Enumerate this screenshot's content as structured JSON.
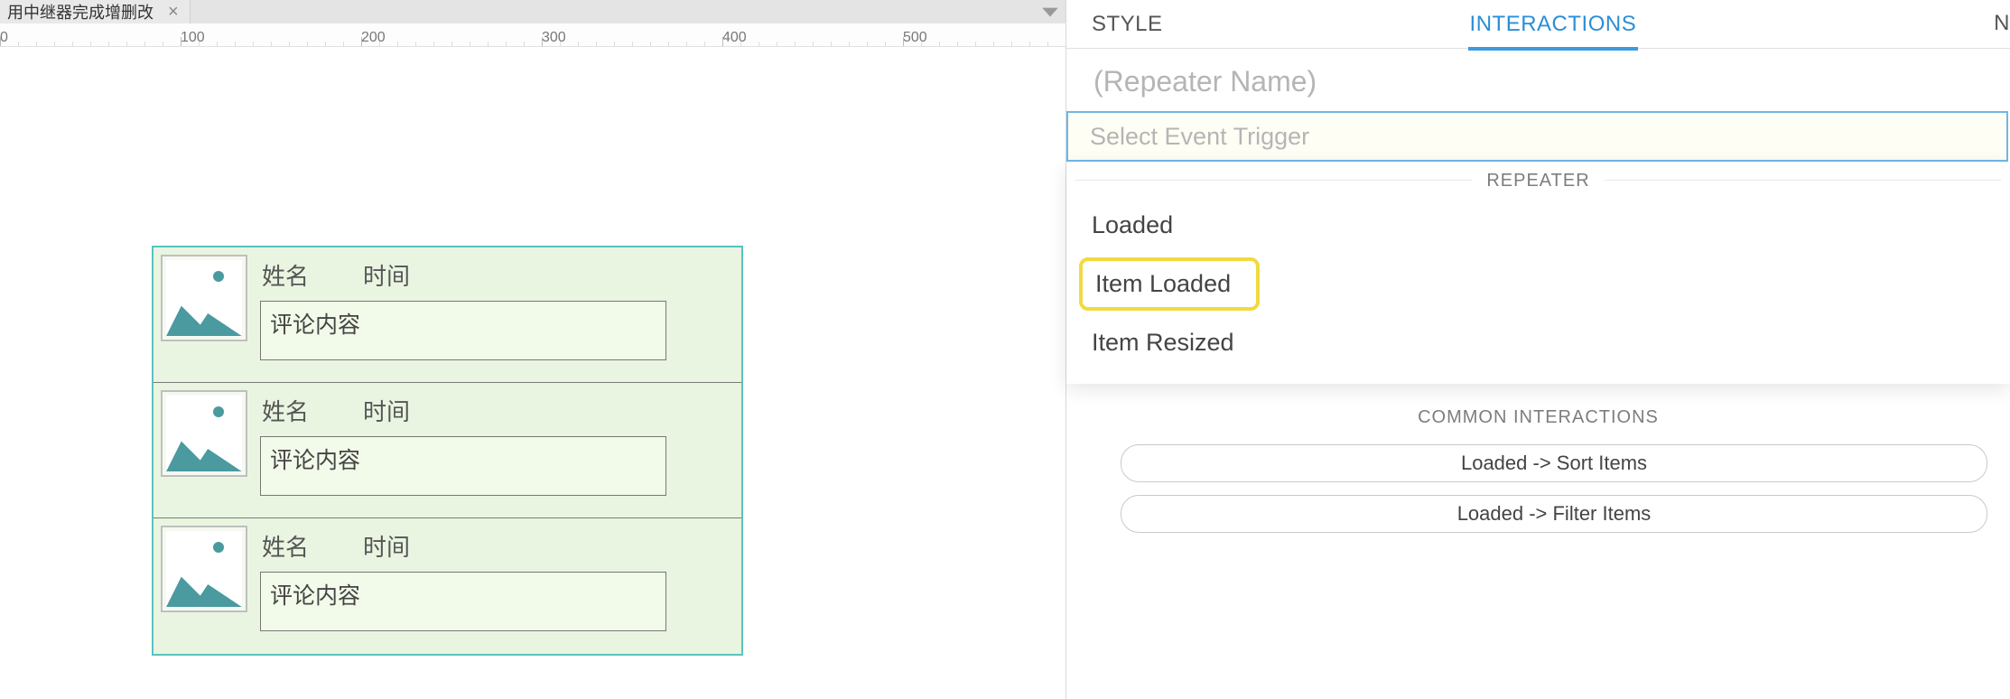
{
  "tab": {
    "title": "用中继器完成增删改"
  },
  "ruler": {
    "marks": [
      "0",
      "100",
      "200",
      "300",
      "400",
      "500"
    ]
  },
  "repeater_item": {
    "name_label": "姓名",
    "time_label": "时间",
    "comment_label": "评论内容"
  },
  "panel": {
    "tabs": {
      "style": "STYLE",
      "interactions": "INTERACTIONS",
      "notes_partial": "N"
    },
    "widget_placeholder": "(Repeater Name)",
    "event_placeholder": "Select Event Trigger",
    "dropdown": {
      "section": "REPEATER",
      "items": [
        "Loaded",
        "Item Loaded",
        "Item Resized"
      ]
    },
    "common": {
      "label": "COMMON INTERACTIONS",
      "buttons": [
        "Loaded -> Sort Items",
        "Loaded -> Filter Items"
      ]
    }
  }
}
